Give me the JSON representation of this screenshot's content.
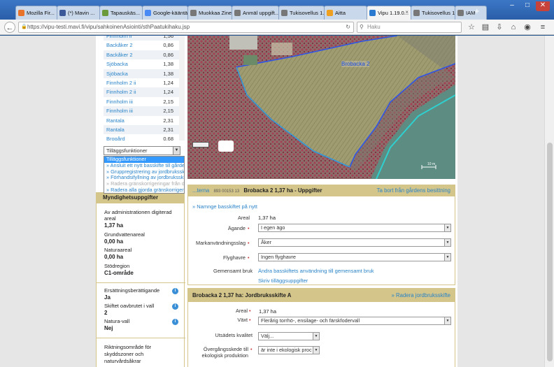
{
  "browser": {
    "tabs": [
      {
        "label": "Mozilla Fir...",
        "color": "#e8732a"
      },
      {
        "label": "(*) Mavin ...",
        "color": "#3b5998"
      },
      {
        "label": "Tapauskäs...",
        "color": "#6a9a3a"
      },
      {
        "label": "Google-kääntä...",
        "color": "#4a8af4"
      },
      {
        "label": "Muokkaa Zine...",
        "color": "#777777"
      },
      {
        "label": "Anmäl uppgift...",
        "color": "#777777"
      },
      {
        "label": "Tukisovellus 1....",
        "color": "#777777"
      },
      {
        "label": "Aitta",
        "color": "#f0a020"
      },
      {
        "label": "Vipu 1.19.0...",
        "color": "#2a7ad0"
      },
      {
        "label": "Tukisovellus 1....",
        "color": "#777777"
      },
      {
        "label": "IAM",
        "color": "#777777"
      }
    ],
    "url": "https://vipu-testi.mavi.fi/vipu/sahkoinenAsiointi/sthPaatukihaku.jsp",
    "search_placeholder": "Haku"
  },
  "plots": [
    {
      "name": "Finnholm ii",
      "area": "1,56"
    },
    {
      "name": "Backåker 2",
      "area": "0,86"
    },
    {
      "name": "Backåker 2",
      "area": "0,86"
    },
    {
      "name": "Sjöbacka",
      "area": "1,38"
    },
    {
      "name": "Sjöbacka",
      "area": "1,38"
    },
    {
      "name": "Finnholm 2 ii",
      "area": "1,24"
    },
    {
      "name": "Finnholm 2 ii",
      "area": "1,24"
    },
    {
      "name": "Finnholm iii",
      "area": "2,15"
    },
    {
      "name": "Finnholm iii",
      "area": "2,15"
    },
    {
      "name": "Rantala",
      "area": "2,31"
    },
    {
      "name": "Rantala",
      "area": "2,31"
    },
    {
      "name": "Brogård",
      "area": "0,68"
    }
  ],
  "tillagg": {
    "selected": "Tilläggsfunktioner",
    "options": [
      "Tilläggsfunktioner",
      "» Ansluit ett nytt basskifte till gårdens besittning",
      "» Gruppregistrering av jordbruksskiftesuppgifter",
      "» Förhandsifyllning av jordbruksskiftesuppgifter",
      "» Radera gränskorrigeringar från det valda basskiftet",
      "» Radera alla gjorda gränskorrigeringar"
    ]
  },
  "map": {
    "label": "Brobacka 2",
    "scale": "10 m"
  },
  "mynd": {
    "title": "Myndighetsuppgifter",
    "areal_label": "Av administrationen digiterad areal",
    "areal_value": "1,37 ha",
    "grund_label": "Grundvattenareal",
    "grund_value": "0,00 ha",
    "natur_label": "Naturaareal",
    "natur_value": "0,00 ha",
    "stod_label": "Stödregion",
    "stod_value": "C1-område",
    "ers_label": "Ersättningsberättigande",
    "ers_value": "Ja",
    "skif_label": "Skiftet oavbrutet i vall",
    "skif_value": "2",
    "natvall_label": "Natura-vall",
    "natvall_value": "Nej",
    "rikt_label": "Riktningsområde för skyddszoner och naturvårdsåkrar"
  },
  "bas": {
    "head_prefix": "...terna",
    "head_code": "893 00153 13",
    "head_title": "Brobacka 2 1,37 ha - Uppgifter",
    "remove_link": "Ta bort från gårdens besittning",
    "rename_link": "» Namnge basskiftet på nytt",
    "areal_label": "Areal",
    "areal_value": "1,37 ha",
    "agande_label": "Ägande",
    "agande_value": "I egen ägo",
    "mark_label": "Markanvändningsslag",
    "mark_value": "Åker",
    "flyg_label": "Flyghavre",
    "flyg_value": "Ingen flyghavre",
    "gem_label": "Gemensamt bruk",
    "gem_link": "Ändra basskiftets användning till gemensamt bruk",
    "print_link": "Skriv tilläggsuppgifter"
  },
  "jb": {
    "head_title": "Brobacka 2 1,37 ha: Jordbruksskifte A",
    "delete_link": "» Radera jordbruksskifte",
    "areal_label": "Areal",
    "areal_value": "1,37 ha",
    "vaxt_label": "Växt",
    "vaxt_value": "Flerårig torrhö-, ensilage- och färskfodervall",
    "uts_label": "Utsädets kvalitet",
    "uts_value": "Välj...",
    "over_label": "Övergångsskede till ekologisk produktion",
    "over_value": "är inte i ekologisk proc"
  }
}
